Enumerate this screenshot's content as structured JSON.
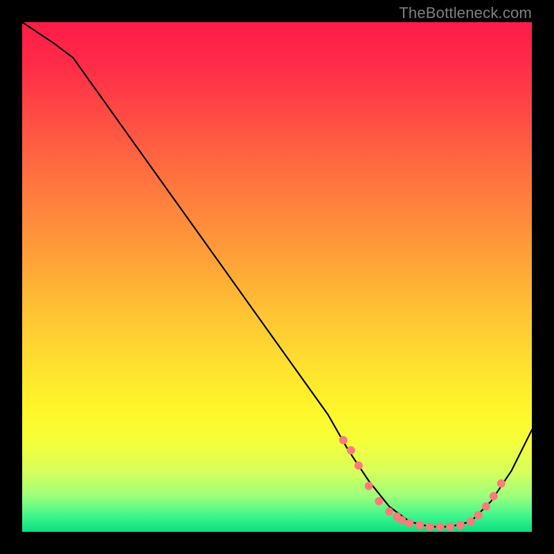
{
  "watermark": "TheBottleneck.com",
  "chart_data": {
    "type": "line",
    "title": "",
    "xlabel": "",
    "ylabel": "",
    "xlim": [
      0,
      100
    ],
    "ylim": [
      0,
      100
    ],
    "grid": false,
    "series": [
      {
        "name": "bottleneck-curve",
        "x": [
          0,
          6,
          10,
          20,
          30,
          40,
          50,
          60,
          64,
          68,
          72,
          76,
          80,
          84,
          88,
          92,
          96,
          100
        ],
        "y": [
          100,
          96,
          93,
          79,
          65,
          51,
          37,
          23,
          16,
          10,
          5,
          2,
          1,
          1,
          2,
          6,
          12,
          20
        ]
      }
    ],
    "markers": {
      "name": "highlight-dots",
      "x": [
        63,
        64.5,
        66,
        68,
        70,
        72,
        73.5,
        74.5,
        76,
        78,
        80,
        82,
        84,
        86,
        88,
        89.5,
        91,
        92.5,
        94
      ],
      "y": [
        18,
        16,
        13,
        9,
        6,
        4,
        3,
        2.3,
        1.7,
        1.3,
        1,
        1,
        1,
        1.3,
        2,
        3.3,
        5,
        7,
        9.5
      ]
    },
    "colors": {
      "curve": "#000000",
      "marker": "#ff7a7a",
      "gradient_top": "#ff1b48",
      "gradient_mid": "#ffe22f",
      "gradient_bottom": "#0adf80",
      "frame": "#000000",
      "watermark": "#7f7f7f"
    }
  }
}
